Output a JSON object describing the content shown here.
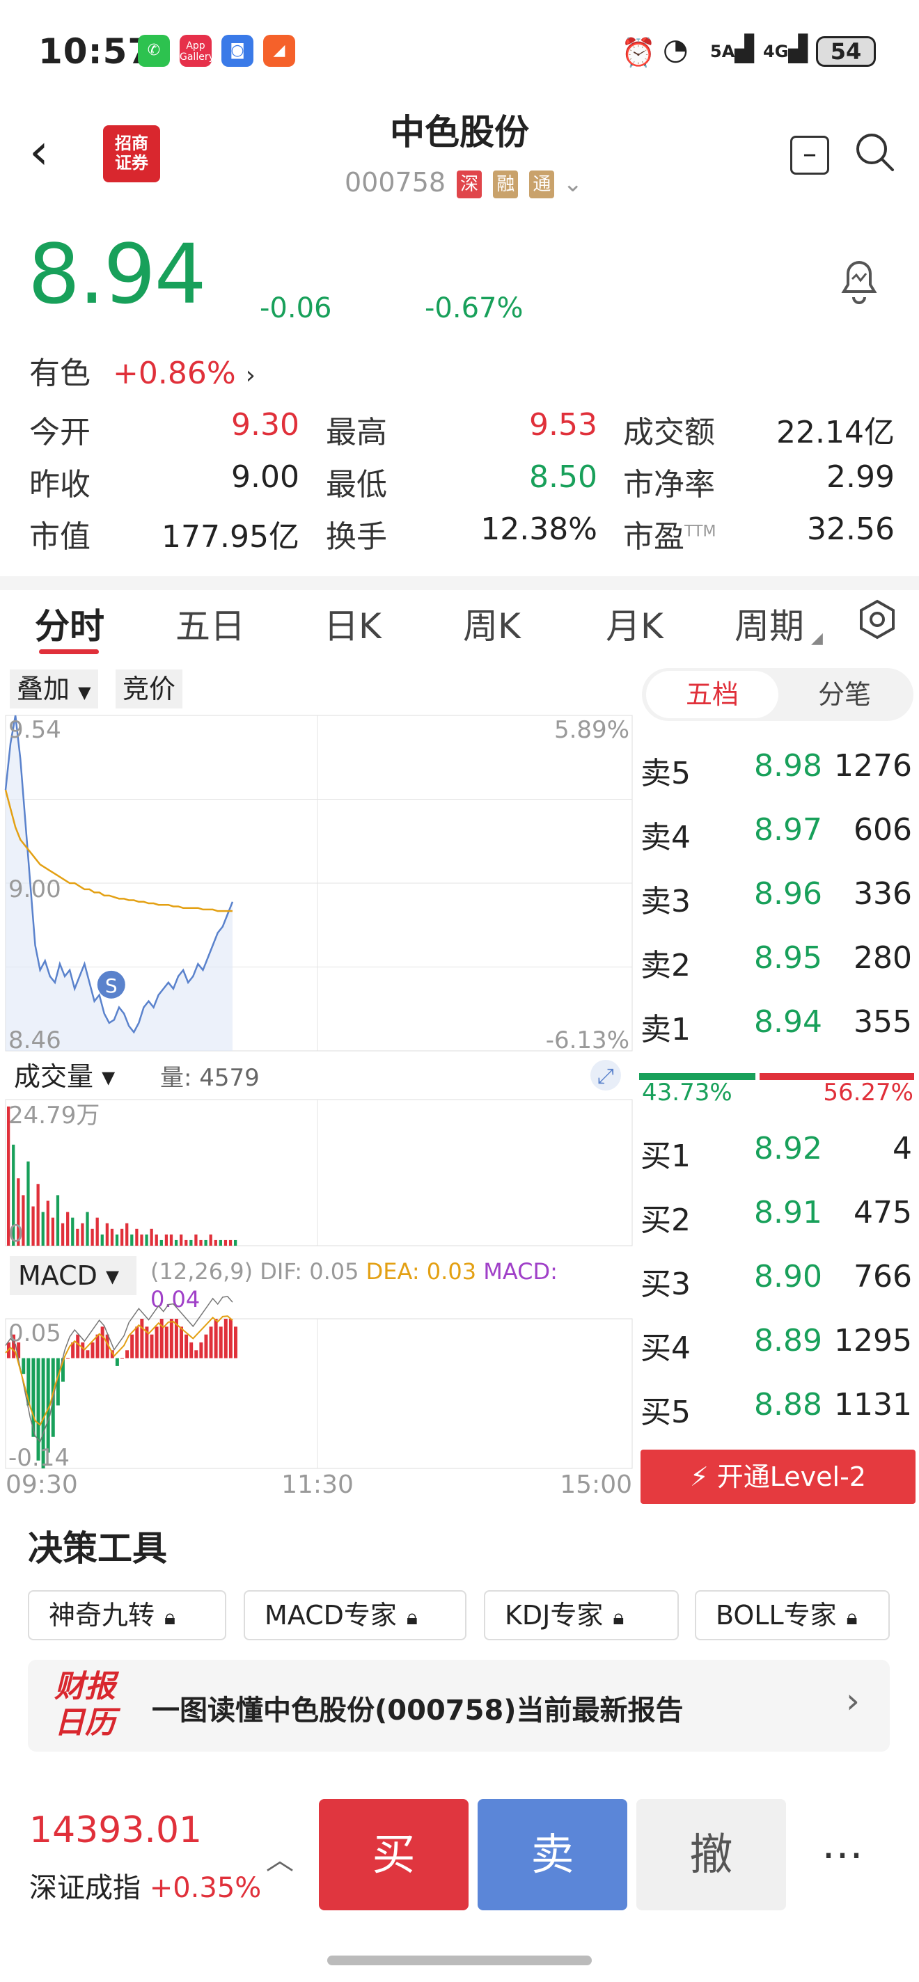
{
  "status_bar": {
    "time": "10:57",
    "signal_5g": "5A",
    "signal_4g": "4G",
    "battery": "54"
  },
  "header": {
    "title": "中色股份",
    "code": "000758",
    "tag_exchange": "深",
    "tag_margin": "融",
    "tag_connect": "通",
    "broker_logo_text": "招商\n证券"
  },
  "quote": {
    "price": "8.94",
    "change": "-0.06",
    "change_pct": "-0.67%",
    "sector_name": "有色",
    "sector_pct": "+0.86%",
    "stats": [
      {
        "label": "今开",
        "value": "9.30"
      },
      {
        "label": "最高",
        "value": "9.53"
      },
      {
        "label": "成交额",
        "value": "22.14亿"
      },
      {
        "label": "昨收",
        "value": "9.00"
      },
      {
        "label": "最低",
        "value": "8.50"
      },
      {
        "label": "市净率",
        "value": "2.99"
      },
      {
        "label": "市值",
        "value": "177.95亿"
      },
      {
        "label": "换手",
        "value": "12.38%"
      },
      {
        "label": "市盈",
        "value": "32.56"
      }
    ],
    "pe_suffix": "TTM"
  },
  "tabs": [
    "分时",
    "五日",
    "日K",
    "周K",
    "月K",
    "周期"
  ],
  "chart_controls": {
    "overlay": "叠加",
    "auction": "竞价",
    "volume_label": "成交量",
    "volume_value": "量: 4579",
    "macd_label": "MACD",
    "macd_params": "(12,26,9)",
    "dif": "DIF: 0.05",
    "dea": "DEA: 0.03",
    "macd": "MACD:",
    "macd_val": "0.04"
  },
  "chart_data": [
    {
      "type": "line",
      "name_price": "",
      "ylim": [
        8.46,
        9.54
      ],
      "y_high_label": "9.54",
      "y_mid_label": "9.00",
      "y_low_label": "8.46",
      "pct_high": "5.89%",
      "pct_low": "-6.13%",
      "x_ticks": [
        "09:30",
        "11:30",
        "15:00"
      ],
      "price": [
        9.3,
        9.45,
        9.54,
        9.4,
        9.2,
        9.0,
        8.8,
        8.72,
        8.75,
        8.7,
        8.68,
        8.74,
        8.7,
        8.72,
        8.66,
        8.7,
        8.74,
        8.68,
        8.62,
        8.64,
        8.58,
        8.55,
        8.56,
        8.6,
        8.58,
        8.54,
        8.52,
        8.55,
        8.6,
        8.62,
        8.6,
        8.64,
        8.66,
        8.68,
        8.66,
        8.7,
        8.72,
        8.68,
        8.7,
        8.74,
        8.72,
        8.76,
        8.8,
        8.84,
        8.86,
        8.9,
        8.94
      ],
      "avg": [
        9.3,
        9.24,
        9.18,
        9.14,
        9.12,
        9.1,
        9.08,
        9.06,
        9.05,
        9.04,
        9.03,
        9.02,
        9.01,
        9.0,
        9.0,
        8.99,
        8.98,
        8.98,
        8.97,
        8.97,
        8.96,
        8.96,
        8.955,
        8.95,
        8.95,
        8.945,
        8.945,
        8.94,
        8.94,
        8.935,
        8.935,
        8.93,
        8.93,
        8.93,
        8.925,
        8.925,
        8.92,
        8.92,
        8.92,
        8.92,
        8.915,
        8.915,
        8.915,
        8.91,
        8.91,
        8.91,
        8.91
      ],
      "marker": "S"
    },
    {
      "type": "bar",
      "ymax_label": "24.79万",
      "ymin_label": "0",
      "values": [
        24.79,
        18,
        12,
        9,
        15,
        7,
        11,
        6,
        8,
        5,
        9,
        4,
        6,
        5,
        3,
        4,
        6,
        3,
        5,
        2,
        4,
        3,
        2,
        3,
        4,
        2,
        3,
        2,
        2,
        3,
        2,
        1,
        2,
        2,
        1,
        2,
        1,
        1,
        2,
        1,
        1,
        2,
        1,
        1,
        1,
        1,
        1
      ]
    },
    {
      "type": "bar",
      "name": "MACD",
      "ymax_label": "0.05",
      "ymin_label": "-0.14",
      "values": [
        0.02,
        0.03,
        0.02,
        -0.02,
        -0.06,
        -0.1,
        -0.13,
        -0.14,
        -0.12,
        -0.1,
        -0.06,
        -0.03,
        0.0,
        0.02,
        0.03,
        0.02,
        0.01,
        0.02,
        0.03,
        0.04,
        0.03,
        0.01,
        -0.01,
        0.0,
        0.01,
        0.03,
        0.04,
        0.05,
        0.04,
        0.03,
        0.04,
        0.05,
        0.04,
        0.05,
        0.05,
        0.04,
        0.03,
        0.02,
        0.01,
        0.02,
        0.03,
        0.04,
        0.05,
        0.04,
        0.05,
        0.05,
        0.04
      ]
    }
  ],
  "orderbook": {
    "tab_active": "五档",
    "tab_other": "分笔",
    "asks": [
      {
        "label": "卖5",
        "price": "8.98",
        "vol": "1276"
      },
      {
        "label": "卖4",
        "price": "8.97",
        "vol": "606"
      },
      {
        "label": "卖3",
        "price": "8.96",
        "vol": "336"
      },
      {
        "label": "卖2",
        "price": "8.95",
        "vol": "280"
      },
      {
        "label": "卖1",
        "price": "8.94",
        "vol": "355"
      }
    ],
    "buy_pct": "43.73%",
    "sell_pct": "56.27%",
    "buy_ratio": 0.4373,
    "bids": [
      {
        "label": "买1",
        "price": "8.92",
        "vol": "4"
      },
      {
        "label": "买2",
        "price": "8.91",
        "vol": "475"
      },
      {
        "label": "买3",
        "price": "8.90",
        "vol": "766"
      },
      {
        "label": "买4",
        "price": "8.89",
        "vol": "1295"
      },
      {
        "label": "买5",
        "price": "8.88",
        "vol": "1131"
      }
    ],
    "level2_label": "开通Level-2"
  },
  "tools": {
    "title": "决策工具",
    "chips": [
      "神奇九转",
      "MACD专家",
      "KDJ专家",
      "BOLL专家"
    ]
  },
  "report": {
    "logo_top": "财报",
    "logo_bottom": "日历",
    "text": "一图读懂中色股份(000758)当前最新报告"
  },
  "bottom": {
    "index_value": "14393.01",
    "index_name": "深证成指",
    "index_pct": "+0.35%",
    "buy": "买",
    "sell": "卖",
    "cancel": "撤",
    "more": "⋯"
  },
  "colors": {
    "up": "#e0303a",
    "down": "#18a05a",
    "buy_btn": "#e0363f",
    "sell_btn": "#5b86d8",
    "avg_line": "#e3a013",
    "price_line": "#5a82cc"
  }
}
